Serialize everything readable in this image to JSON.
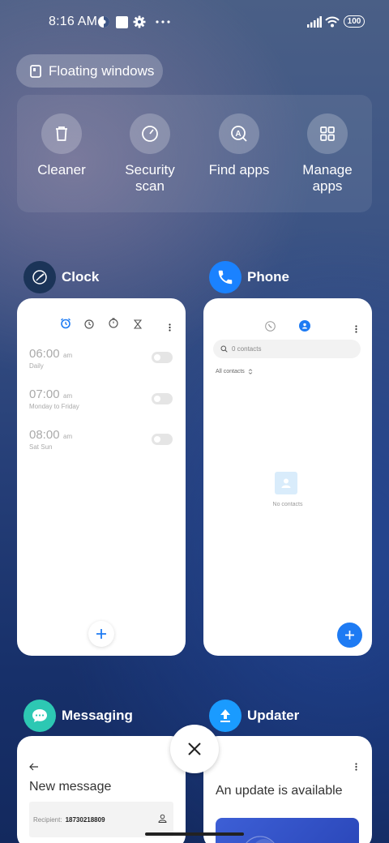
{
  "status_bar": {
    "time": "8:16 AM",
    "battery": "100"
  },
  "floating_windows": {
    "label": "Floating windows"
  },
  "tools": [
    {
      "label": "Cleaner",
      "icon": "trash-icon"
    },
    {
      "label": "Security\nscan",
      "icon": "security-scan-icon"
    },
    {
      "label": "Find apps",
      "icon": "find-apps-icon"
    },
    {
      "label": "Manage\napps",
      "icon": "grid-icon"
    }
  ],
  "apps": {
    "clock": {
      "name": "Clock",
      "alarms": [
        {
          "time": "06:00",
          "ampm": "am",
          "repeat": "Daily"
        },
        {
          "time": "07:00",
          "ampm": "am",
          "repeat": "Monday to Friday"
        },
        {
          "time": "08:00",
          "ampm": "am",
          "repeat": "Sat Sun"
        }
      ]
    },
    "phone": {
      "name": "Phone",
      "search_placeholder": "0 contacts",
      "filter": "All contacts",
      "empty": "No contacts"
    },
    "messaging": {
      "name": "Messaging",
      "title": "New message",
      "recipient_label": "Recipient:",
      "recipient_value": "18730218809"
    },
    "updater": {
      "name": "Updater",
      "title": "An update is available"
    }
  },
  "colors": {
    "accent": "#1e7bf3",
    "phone_icon": "#1a82ff",
    "messaging_icon": "#2dc8b3",
    "updater_icon": "#1a9bff",
    "clock_icon": "#1b3458"
  }
}
